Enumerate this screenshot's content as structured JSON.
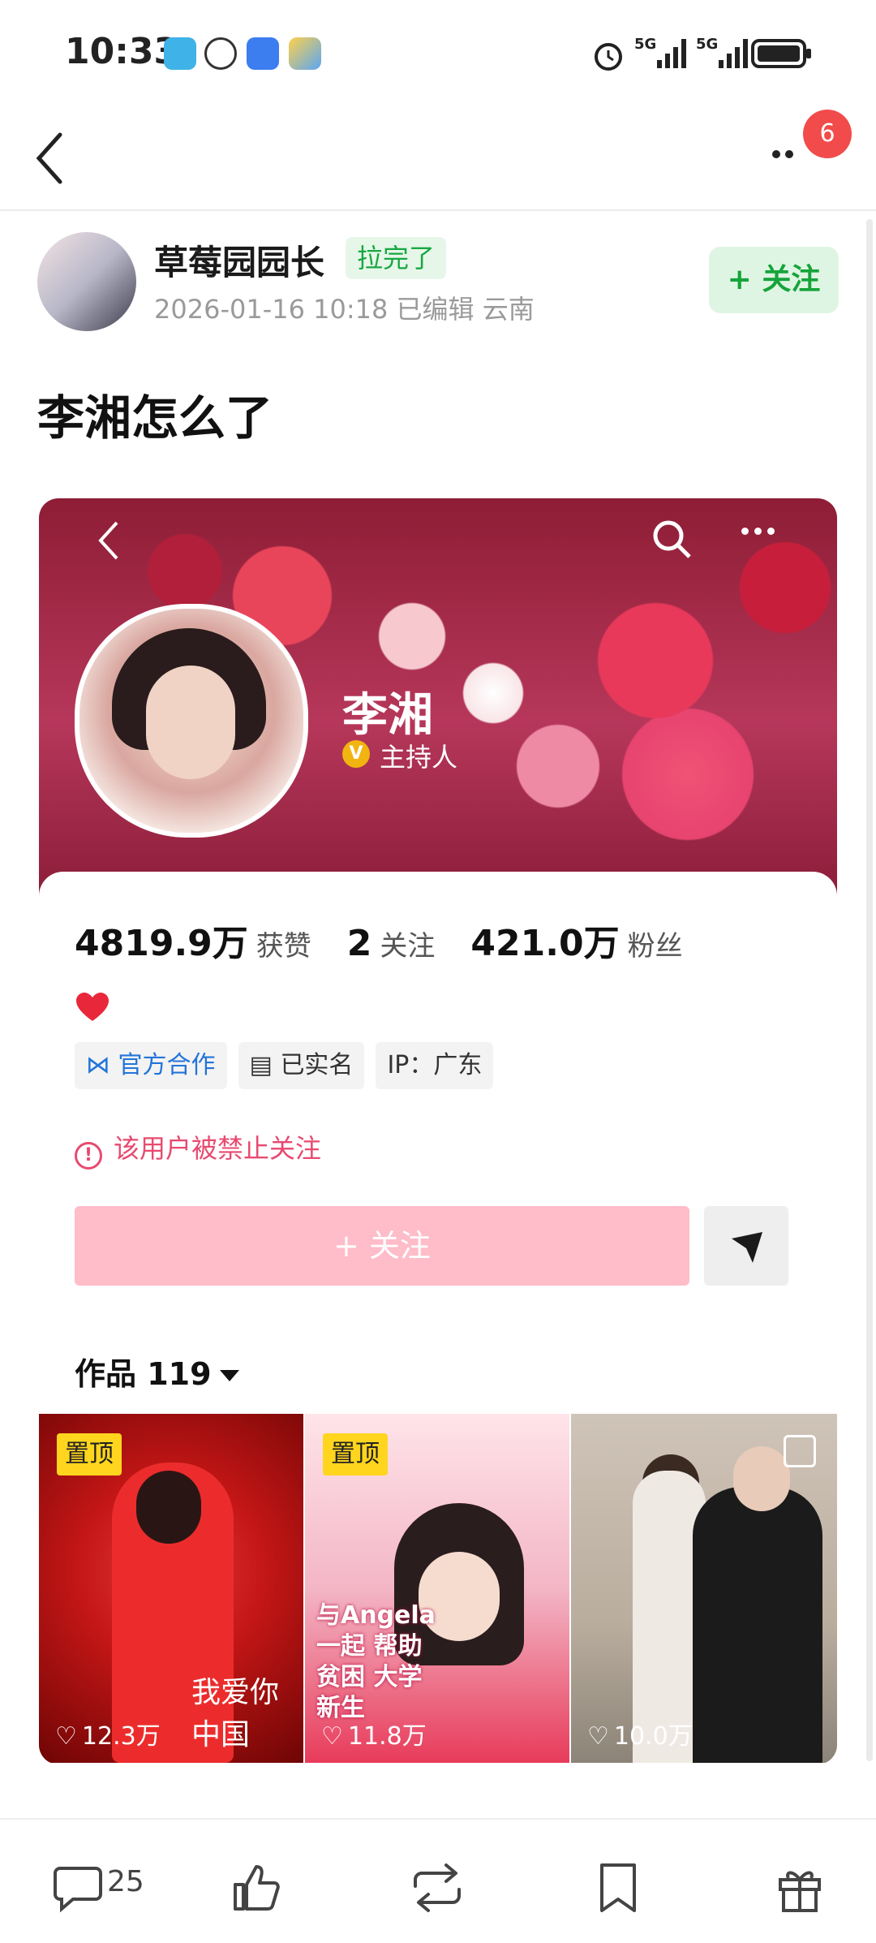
{
  "status_bar": {
    "time": "10:33"
  },
  "nav": {
    "badge_count": "6"
  },
  "post": {
    "author": {
      "name": "草莓园园长",
      "tag": "拉完了",
      "meta": "2026-01-16 10:18 已编辑 云南"
    },
    "follow_label": "+ 关注",
    "title": "李湘怎么了"
  },
  "profile": {
    "name": "李湘",
    "role": "主持人",
    "stats": [
      {
        "value": "4819.9万",
        "label": "获赞"
      },
      {
        "value": "2",
        "label": "关注"
      },
      {
        "value": "421.0万",
        "label": "粉丝"
      }
    ],
    "tags": [
      "官方合作",
      "已实名",
      "IP：广东"
    ],
    "ban_notice": "该用户被禁止关注",
    "follow_button": "+ 关注",
    "works_label": "作品 119"
  },
  "thumbnails": [
    {
      "pin": "置顶",
      "likes": "12.3万",
      "slogan": "我爱你中国"
    },
    {
      "pin": "置顶",
      "likes": "11.8万",
      "caption": "与Angela 一起 帮助贫困 大学新生"
    },
    {
      "pin": "",
      "likes": "10.0万"
    }
  ],
  "bottom_bar": {
    "comment_count": "25"
  },
  "colors": {
    "accent_green": "#15a43a",
    "follow_pink": "#ffbcc9",
    "ban_red": "#e84a70",
    "badge_red": "#f24b4b"
  }
}
